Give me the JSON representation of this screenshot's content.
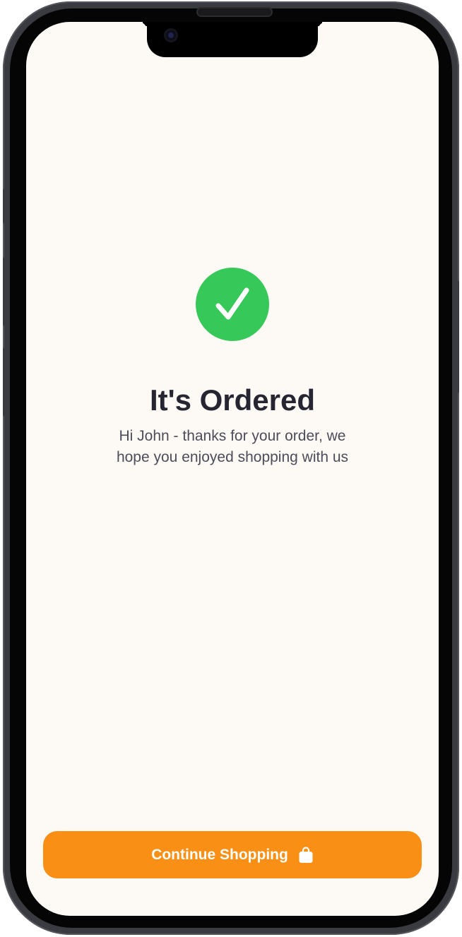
{
  "confirmation": {
    "title": "It's Ordered",
    "message": "Hi John - thanks for your order, we hope you enjoyed shopping with us",
    "status_icon": "checkmark-circle-icon"
  },
  "actions": {
    "continue_label": "Continue Shopping",
    "continue_icon": "shopping-bag-icon"
  },
  "colors": {
    "success": "#37c85a",
    "accent": "#f98f14",
    "background": "#fdf9f4",
    "title_text": "#252631",
    "body_text": "#4d4d5a"
  }
}
